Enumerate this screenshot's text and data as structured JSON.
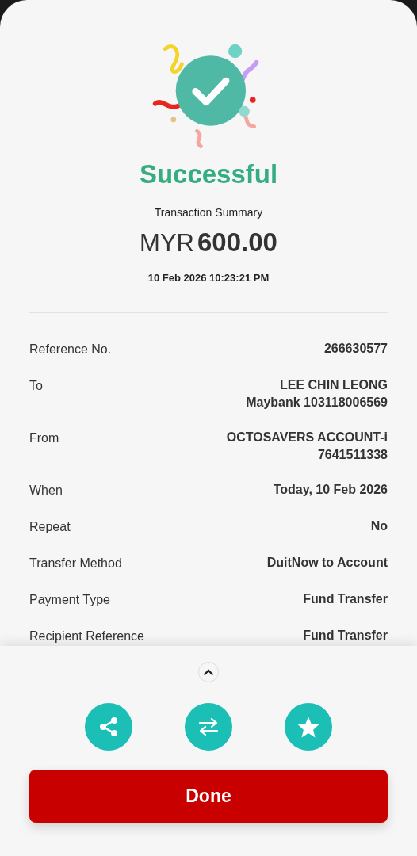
{
  "status": "Successful",
  "summary_label": "Transaction Summary",
  "amount": {
    "currency": "MYR",
    "value": "600.00"
  },
  "datetime": "10 Feb 2026 10:23:21 PM",
  "details": [
    {
      "label": "Reference No.",
      "value_lines": [
        "266630577"
      ]
    },
    {
      "label": "To",
      "value_lines": [
        "LEE CHIN LEONG",
        "Maybank 103118006569"
      ]
    },
    {
      "label": "From",
      "value_lines": [
        "OCTOSAVERS ACCOUNT-i",
        "7641511338"
      ]
    },
    {
      "label": "When",
      "value_lines": [
        "Today, 10 Feb 2026"
      ]
    },
    {
      "label": "Repeat",
      "value_lines": [
        "No"
      ]
    },
    {
      "label": "Transfer Method",
      "value_lines": [
        "DuitNow to Account"
      ]
    },
    {
      "label": "Payment Type",
      "value_lines": [
        "Fund Transfer"
      ]
    },
    {
      "label": "Recipient Reference",
      "value_lines": [
        "Fund Transfer"
      ]
    }
  ],
  "actions": [
    {
      "kind": "share"
    },
    {
      "kind": "transfer"
    },
    {
      "kind": "favourite"
    }
  ],
  "done_button": "Done"
}
